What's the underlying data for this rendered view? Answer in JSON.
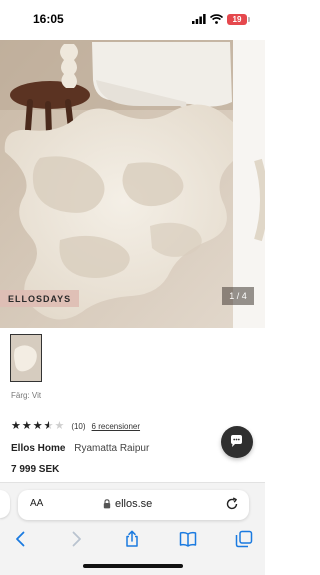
{
  "status_bar": {
    "time": "16:05",
    "battery_level": "19",
    "icons": [
      "signal-icon",
      "wifi-icon",
      "battery-icon"
    ]
  },
  "gallery": {
    "promo_badge": "ELLOSDAYS",
    "slide_counter": "1 / 4"
  },
  "product": {
    "color_label": "Färg: Vit",
    "rating_value": 3.5,
    "rating_max": 5,
    "rating_count": "(10)",
    "reviews_link": "6 recensioner",
    "brand": "Ellos Home",
    "name": "Ryamatta Raipur",
    "price": "7 999 SEK"
  },
  "browser": {
    "text_size_label": "AA",
    "url": "ellos.se",
    "toolbar_icons": [
      "back-icon",
      "forward-icon",
      "share-icon",
      "bookmarks-icon",
      "tabs-icon"
    ]
  },
  "colors": {
    "accent": "#1a7ae0",
    "badge_bg": "#debeb4",
    "battery": "#e5484d",
    "chat_fab": "#2f2f2f"
  }
}
